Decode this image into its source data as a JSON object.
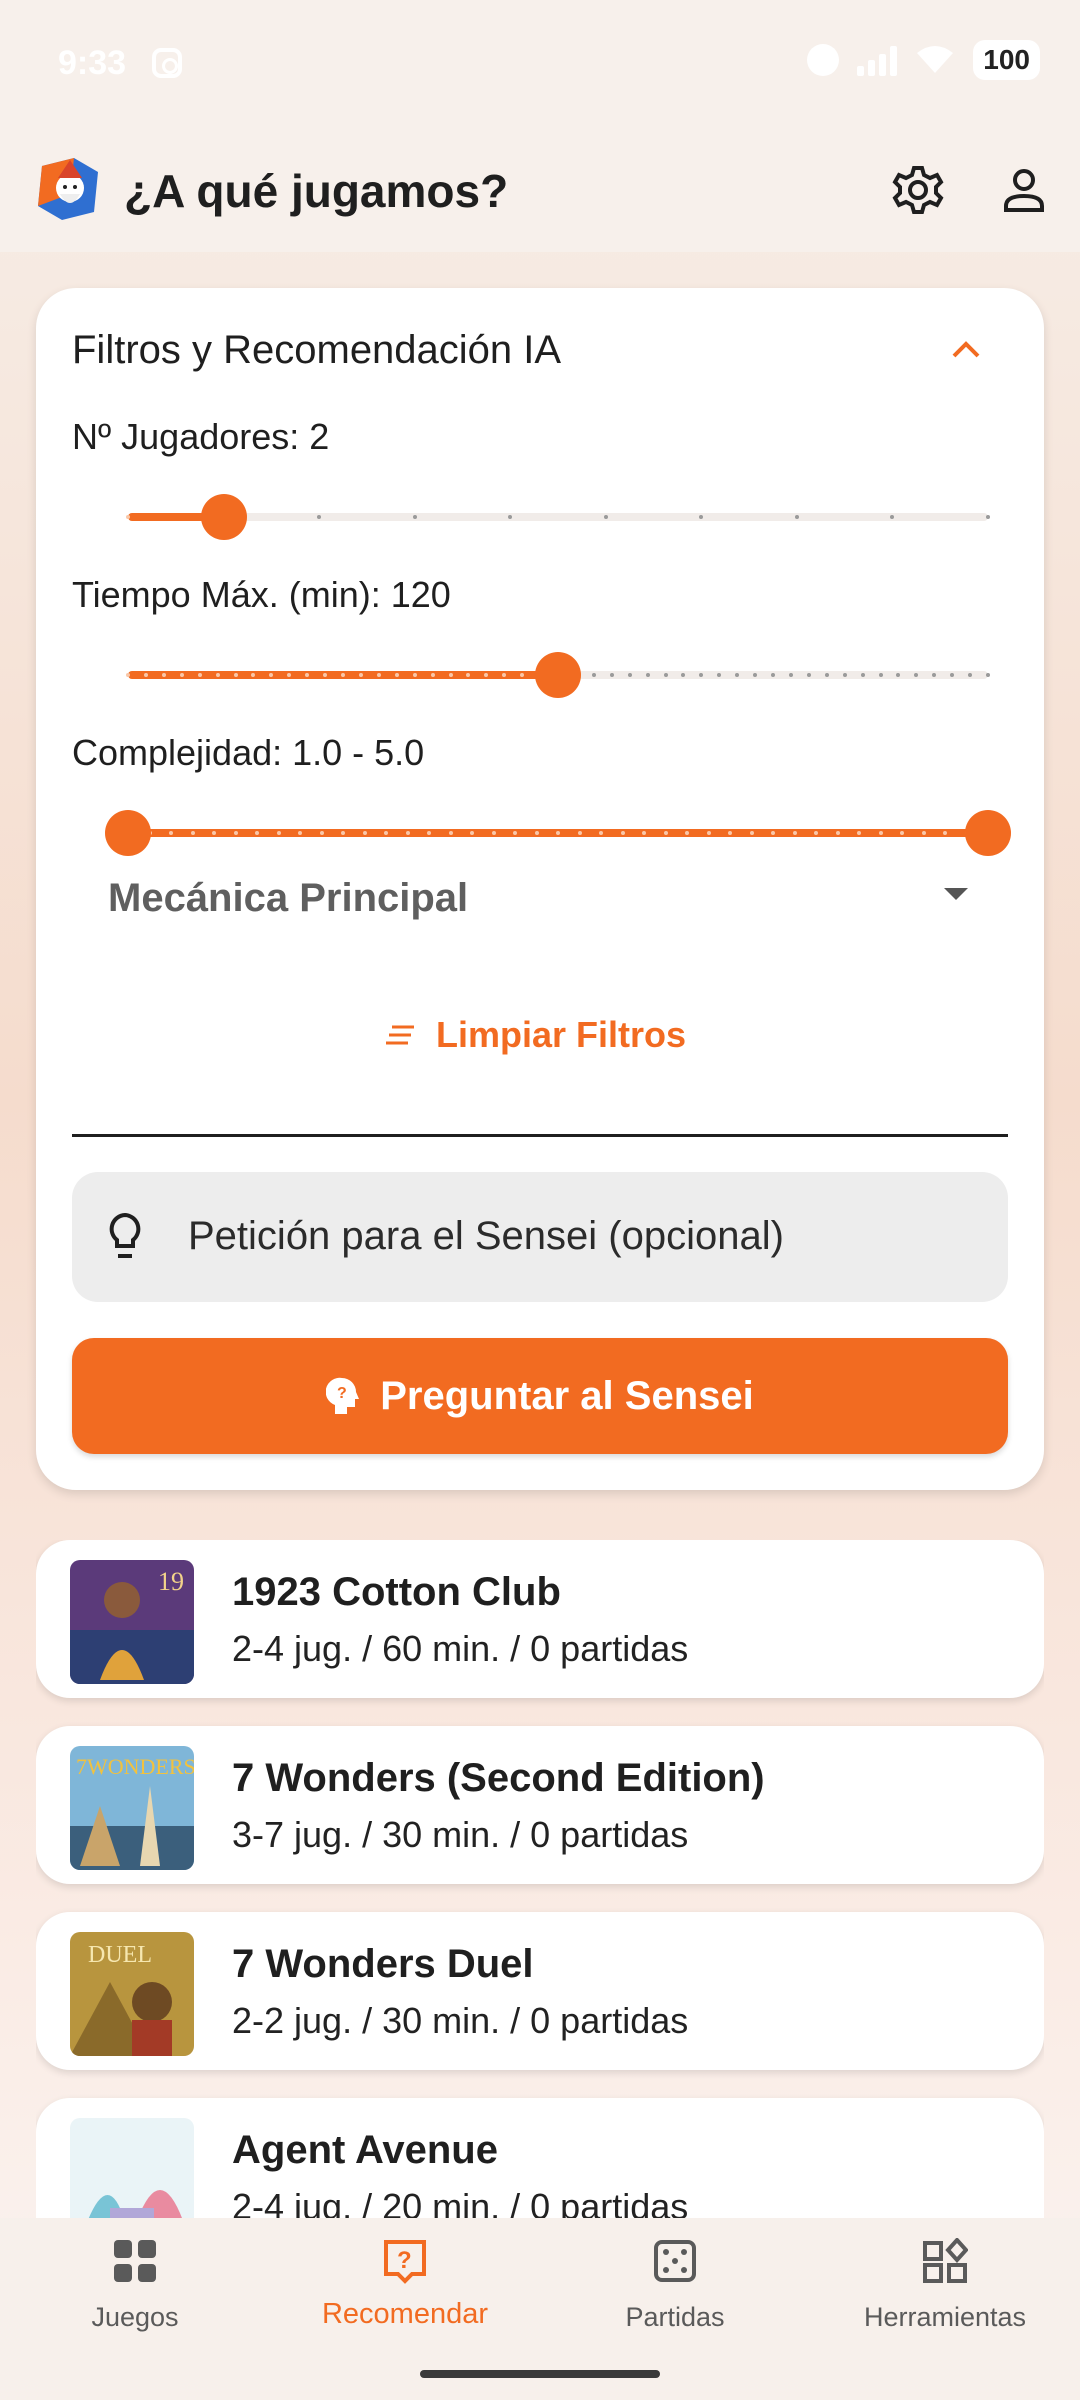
{
  "status_bar": {
    "time": "9:33",
    "battery": "100"
  },
  "app_bar": {
    "title": "¿A qué jugamos?"
  },
  "filters": {
    "title": "Filtros y Recomendación IA",
    "players": {
      "label": "Nº Jugadores: 2",
      "min": 1,
      "max": 10,
      "value": 2
    },
    "time": {
      "label": "Tiempo Máx. (min): 120",
      "min": 0,
      "max": 240,
      "value": 120
    },
    "complexity": {
      "label": "Complejidad: 1.0 - 5.0",
      "min": 1.0,
      "max": 5.0,
      "low": 1.0,
      "high": 5.0
    },
    "mechanic_placeholder": "Mecánica Principal",
    "clear_label": "Limpiar Filtros",
    "request_placeholder": "Petición para el Sensei (opcional)",
    "ask_label": "Preguntar al Sensei"
  },
  "games": [
    {
      "name": "1923 Cotton Club",
      "meta": "2-4 jug. / 60 min. / 0 partidas"
    },
    {
      "name": "7 Wonders (Second Edition)",
      "meta": "3-7 jug. / 30 min. / 0 partidas"
    },
    {
      "name": "7 Wonders Duel",
      "meta": "2-2 jug. / 30 min. / 0 partidas"
    },
    {
      "name": "Agent Avenue",
      "meta": "2-4 jug. / 20 min. / 0 partidas"
    }
  ],
  "nav": {
    "items": [
      {
        "label": "Juegos",
        "icon": "grid-icon"
      },
      {
        "label": "Recomendar",
        "icon": "question-icon"
      },
      {
        "label": "Partidas",
        "icon": "dice-icon"
      },
      {
        "label": "Herramientas",
        "icon": "widgets-icon"
      }
    ],
    "active_index": 1
  },
  "colors": {
    "accent": "#f26b21",
    "background": "#f7f0eb"
  }
}
